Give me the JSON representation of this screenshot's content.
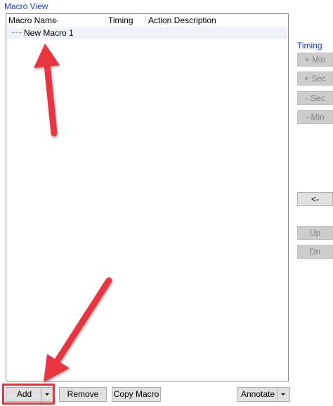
{
  "panel": {
    "title": "Macro View"
  },
  "tree": {
    "columns": [
      {
        "label": "Macro Name"
      },
      {
        "label": "Timing"
      },
      {
        "label": "Action Description"
      }
    ],
    "rows": [
      {
        "name": "New Macro 1"
      }
    ]
  },
  "timing": {
    "label": "Timing",
    "plus_min": "+ Min",
    "plus_sec": "+ Sec",
    "minus_sec": "- Sec",
    "minus_min": "- Min"
  },
  "side": {
    "insert": "<-",
    "up": "Up",
    "down": "Dn"
  },
  "bottom": {
    "add": "Add",
    "remove": "Remove",
    "copy_macro": "Copy Macro",
    "annotate": "Annotate"
  },
  "colors": {
    "accent_text": "#1a3cc8",
    "annotation_red": "#e8343f",
    "selected_row": "#eef3fa"
  }
}
